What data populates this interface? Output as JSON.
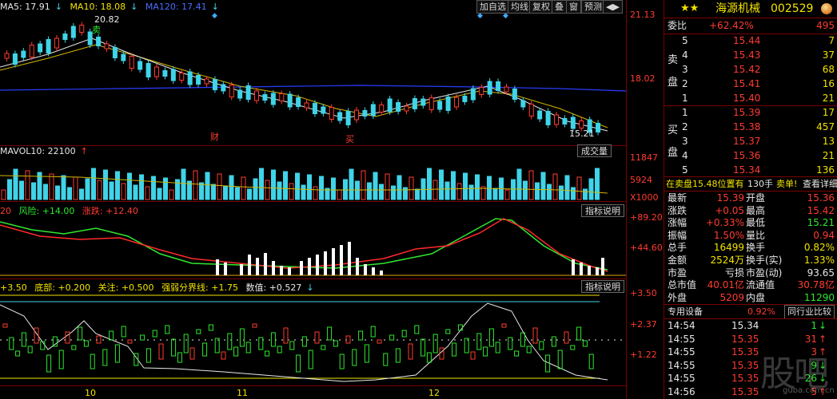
{
  "legend_ma": {
    "ma5": "MA5: 17.91",
    "ma10": "MA10: 18.08",
    "ma120": "MA120: 17.41"
  },
  "price_axis": {
    "p1": "21.13",
    "p2": "18.02"
  },
  "price_marks": {
    "high": "20.82",
    "low": "15.21",
    "sell": "卖",
    "buy": "买",
    "cai": "财"
  },
  "toolbar": {
    "b1": "加自选",
    "b2": "均线",
    "b3": "复权",
    "b4": "叠",
    "b5": "窗",
    "b6": "预测",
    "b7": "◀▶"
  },
  "volume": {
    "legend": "MAVOL10: 22100",
    "label": "成交量",
    "a1": "11847",
    "a2": "5924",
    "a3": "X1000"
  },
  "ind1": {
    "l1": "20",
    "l2": "风险: +14.00",
    "l3": "涨跌: +12.40",
    "btn": "指标说明",
    "a1": "+89.20",
    "a2": "+44.60"
  },
  "ind2": {
    "l1": "+3.50",
    "l2": "底部: +0.200",
    "l3": "关注: +0.500",
    "l4": "强弱分界线: +1.75",
    "l5": "数值: +0.527",
    "btn": "指标说明",
    "a1": "+3.50",
    "a2": "+2.37",
    "a3": "+1.22"
  },
  "xaxis": {
    "m1": "10",
    "m2": "11",
    "m3": "12"
  },
  "header": {
    "name": "海源机械",
    "code": "002529"
  },
  "weibi": {
    "label": "委比",
    "value": "+62.42%",
    "diff": "495"
  },
  "sell_label": "卖盘",
  "buy_label": "买盘",
  "asks": [
    {
      "lvl": "5",
      "price": "15.44",
      "vol": "7"
    },
    {
      "lvl": "4",
      "price": "15.43",
      "vol": "37"
    },
    {
      "lvl": "3",
      "price": "15.42",
      "vol": "68"
    },
    {
      "lvl": "2",
      "price": "15.41",
      "vol": "16"
    },
    {
      "lvl": "1",
      "price": "15.40",
      "vol": "21"
    }
  ],
  "bids": [
    {
      "lvl": "1",
      "price": "15.39",
      "vol": "17"
    },
    {
      "lvl": "2",
      "price": "15.38",
      "vol": "457"
    },
    {
      "lvl": "3",
      "price": "15.37",
      "vol": "13"
    },
    {
      "lvl": "4",
      "price": "15.36",
      "vol": "21"
    },
    {
      "lvl": "5",
      "price": "15.34",
      "vol": "136"
    }
  ],
  "notice": {
    "text": "在卖盘15.48位置有",
    "qty": "130手",
    "action": "卖单!",
    "link": "查看详细"
  },
  "stats": [
    {
      "k1": "最新",
      "v1": "15.39",
      "k2": "开盘",
      "v2": "15.36"
    },
    {
      "k1": "涨跌",
      "v1": "+0.05",
      "k2": "最高",
      "v2": "15.42"
    },
    {
      "k1": "涨幅",
      "v1": "+0.33%",
      "k2": "最低",
      "v2": "15.21"
    },
    {
      "k1": "振幅",
      "v1": "1.50%",
      "k2": "量比",
      "v2": "0.94"
    },
    {
      "k1": "总手",
      "v1": "16499",
      "k2": "换手",
      "v2": "0.82%"
    },
    {
      "k1": "金额",
      "v1": "2524万",
      "k2": "换手(实)",
      "v2": "1.33%"
    },
    {
      "k1": "市盈",
      "v1": "亏损",
      "k2": "市盈(动)",
      "v2": "93.65"
    },
    {
      "k1": "总市值",
      "v1": "40.01亿",
      "k2": "流通值",
      "v2": "30.78亿"
    },
    {
      "k1": "外盘",
      "v1": "5209",
      "k2": "内盘",
      "v2": "11290"
    }
  ],
  "device": {
    "label": "专用设备",
    "pct": "0.92%",
    "btn": "同行业比较"
  },
  "ticks": [
    {
      "t": "14:54",
      "p": "15.34",
      "v": "1"
    },
    {
      "t": "14:55",
      "p": "15.35",
      "v": "31"
    },
    {
      "t": "14:55",
      "p": "15.35",
      "v": "3"
    },
    {
      "t": "14:55",
      "p": "15.35",
      "v": "9"
    },
    {
      "t": "14:55",
      "p": "15.35",
      "v": "26"
    },
    {
      "t": "14:56",
      "p": "15.35",
      "v": "5"
    }
  ],
  "watermark": {
    "text": "股吧",
    "url": "guba.com.cn"
  },
  "colors": {
    "up": "#ff3b30",
    "down": "#3fd4e8",
    "bg": "#000000",
    "grid": "#7a0000",
    "price": "#ffe100"
  }
}
